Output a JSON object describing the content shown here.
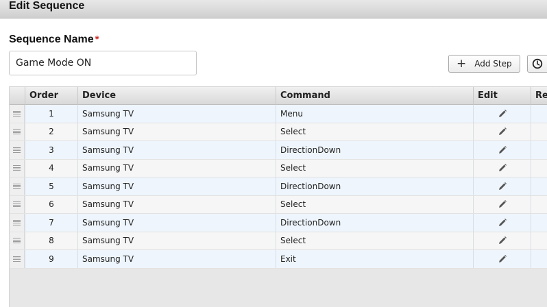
{
  "header": {
    "title": "Edit Sequence"
  },
  "form": {
    "name_label": "Sequence Name",
    "required_mark": "*",
    "name_value": "Game Mode ON"
  },
  "toolbar": {
    "add_step_label": "Add Step",
    "add_icon": "plus-icon",
    "history_icon": "clock-icon"
  },
  "table": {
    "columns": {
      "order": "Order",
      "device": "Device",
      "command": "Command",
      "edit": "Edit",
      "re": "Re"
    },
    "rows": [
      {
        "order": "1",
        "device": "Samsung TV",
        "command": "Menu"
      },
      {
        "order": "2",
        "device": "Samsung TV",
        "command": "Select"
      },
      {
        "order": "3",
        "device": "Samsung TV",
        "command": "DirectionDown"
      },
      {
        "order": "4",
        "device": "Samsung TV",
        "command": "Select"
      },
      {
        "order": "5",
        "device": "Samsung TV",
        "command": "DirectionDown"
      },
      {
        "order": "6",
        "device": "Samsung TV",
        "command": "Select"
      },
      {
        "order": "7",
        "device": "Samsung TV",
        "command": "DirectionDown"
      },
      {
        "order": "8",
        "device": "Samsung TV",
        "command": "Select"
      },
      {
        "order": "9",
        "device": "Samsung TV",
        "command": "Exit"
      }
    ]
  },
  "colors": {
    "required": "#d0342c",
    "row_alt": "#eef5fc",
    "row": "#f6f6f6"
  }
}
